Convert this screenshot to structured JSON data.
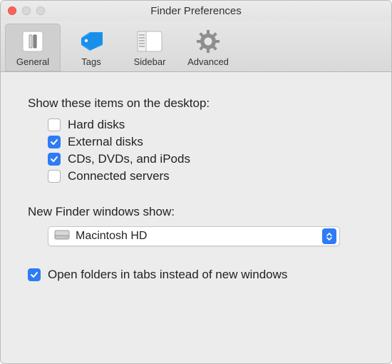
{
  "window": {
    "title": "Finder Preferences"
  },
  "tabs": {
    "general": "General",
    "tags": "Tags",
    "sidebar": "Sidebar",
    "advanced": "Advanced"
  },
  "desktop": {
    "heading": "Show these items on the desktop:",
    "hard_disks": "Hard disks",
    "external_disks": "External disks",
    "cds_dvds_ipods": "CDs, DVDs, and iPods",
    "connected_servers": "Connected servers"
  },
  "checked": {
    "hard_disks": false,
    "external_disks": true,
    "cds_dvds_ipods": true,
    "connected_servers": false,
    "open_in_tabs": true
  },
  "new_windows": {
    "heading": "New Finder windows show:",
    "value": "Macintosh HD"
  },
  "open_in_tabs_label": "Open folders in tabs instead of new windows",
  "colors": {
    "accent": "#2e7bf6"
  }
}
